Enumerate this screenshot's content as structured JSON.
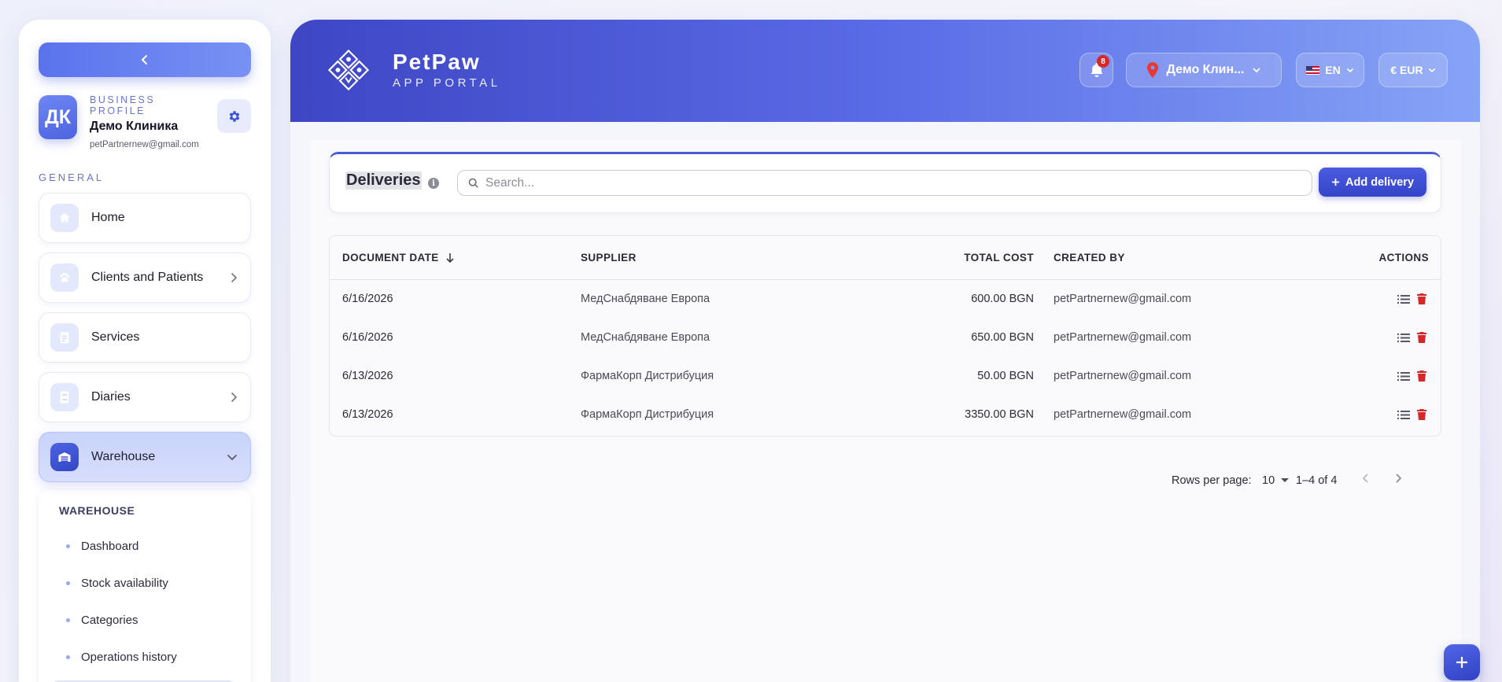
{
  "sidebar": {
    "profile": {
      "initials": "ДК",
      "label": "BUSINESS PROFILE",
      "name": "Демо Клиника",
      "email": "petPartnernew@gmail.com"
    },
    "section_label": "GENERAL",
    "items": [
      {
        "label": "Home",
        "icon": "home-icon",
        "has_chevron": false
      },
      {
        "label": "Clients and Patients",
        "icon": "paw-icon",
        "has_chevron": true
      },
      {
        "label": "Services",
        "icon": "clipboard-icon",
        "has_chevron": false
      },
      {
        "label": "Diaries",
        "icon": "diary-icon",
        "has_chevron": true
      },
      {
        "label": "Warehouse",
        "icon": "warehouse-icon",
        "has_chevron": true,
        "active": true
      }
    ],
    "submenu": {
      "title": "WAREHOUSE",
      "items": [
        {
          "label": "Dashboard"
        },
        {
          "label": "Stock availability"
        },
        {
          "label": "Categories"
        },
        {
          "label": "Operations history"
        }
      ]
    }
  },
  "header": {
    "brand_name": "PetPaw",
    "brand_sub": "APP PORTAL",
    "notifications_count": "8",
    "clinic": "Демо Клин...",
    "language": "EN",
    "currency": "€ EUR"
  },
  "toolbar": {
    "title": "Deliveries",
    "search_placeholder": "Search...",
    "add_label": "Add delivery"
  },
  "table": {
    "columns": [
      "DOCUMENT DATE",
      "SUPPLIER",
      "TOTAL COST",
      "CREATED BY",
      "ACTIONS"
    ],
    "rows": [
      {
        "date": "6/16/2026",
        "supplier": "МедСнабдяване Европа",
        "cost": "600.00 BGN",
        "created_by": "petPartnernew@gmail.com"
      },
      {
        "date": "6/16/2026",
        "supplier": "МедСнабдяване Европа",
        "cost": "650.00 BGN",
        "created_by": "petPartnernew@gmail.com"
      },
      {
        "date": "6/13/2026",
        "supplier": "ФармаКорп Дистрибуция",
        "cost": "50.00 BGN",
        "created_by": "petPartnernew@gmail.com"
      },
      {
        "date": "6/13/2026",
        "supplier": "ФармаКорп Дистрибуция",
        "cost": "3350.00 BGN",
        "created_by": "petPartnernew@gmail.com"
      }
    ]
  },
  "pagination": {
    "rows_label": "Rows per page:",
    "rows_value": "10",
    "range": "1–4 of 4"
  },
  "colors": {
    "accent": "#4a5bd8",
    "header_start": "#3e46c4",
    "header_end": "#86a4f6",
    "danger": "#d62828"
  }
}
